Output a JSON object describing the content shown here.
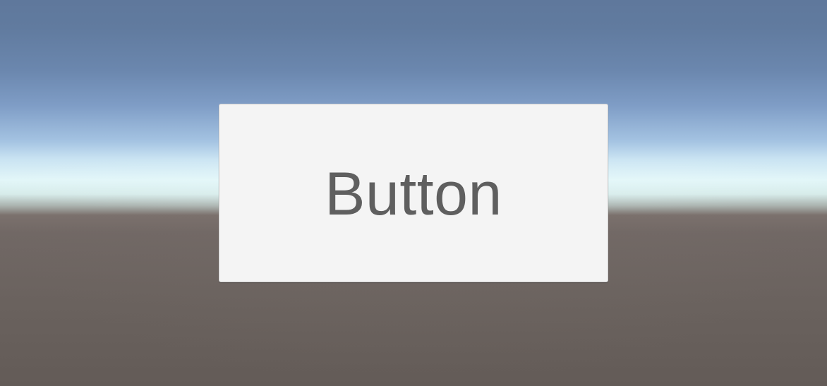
{
  "scene": {
    "sky_top_color": "#5f789c",
    "horizon_color": "#e2f6f8",
    "ground_color": "#6a625e"
  },
  "button": {
    "label": "Button",
    "background_color": "#f4f4f4",
    "text_color": "#5f5f5f"
  }
}
